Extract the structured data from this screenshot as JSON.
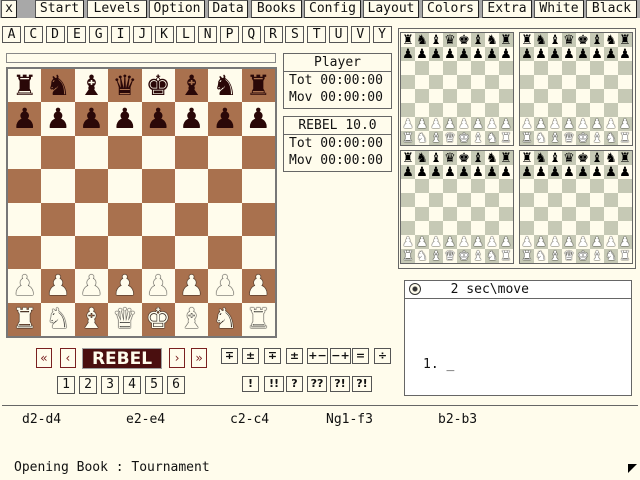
{
  "menu": {
    "close": "x",
    "items": [
      "Start",
      "Levels",
      "Option",
      "Data",
      "Books",
      "Config",
      "Layout",
      "Colors",
      "Extra",
      "White",
      "Black"
    ]
  },
  "letters": [
    "A",
    "C",
    "D",
    "E",
    "G",
    "I",
    "J",
    "K",
    "L",
    "N",
    "P",
    "Q",
    "R",
    "S",
    "T",
    "U",
    "V",
    "Y"
  ],
  "board": {
    "rows": [
      [
        "♜",
        "♞",
        "♝",
        "♛",
        "♚",
        "♝",
        "♞",
        "♜"
      ],
      [
        "♟",
        "♟",
        "♟",
        "♟",
        "♟",
        "♟",
        "♟",
        "♟"
      ],
      [
        "",
        "",
        "",
        "",
        "",
        "",
        "",
        ""
      ],
      [
        "",
        "",
        "",
        "",
        "",
        "",
        "",
        ""
      ],
      [
        "",
        "",
        "",
        "",
        "",
        "",
        "",
        ""
      ],
      [
        "",
        "",
        "",
        "",
        "",
        "",
        "",
        ""
      ],
      [
        "♟",
        "♟",
        "♟",
        "♟",
        "♟",
        "♟",
        "♟",
        "♟"
      ],
      [
        "♜",
        "♞",
        "♝",
        "♛",
        "♚",
        "♝",
        "♞",
        "♜"
      ]
    ],
    "colors": {
      "light": "#fffcec",
      "dark": "#a9714e"
    }
  },
  "clock_player": {
    "name": "Player",
    "tot": "Tot 00:00:00",
    "mov": "Mov 00:00:00"
  },
  "clock_engine": {
    "name": "REBEL 10.0",
    "tot": "Tot 00:00:00",
    "mov": "Mov 00:00:00"
  },
  "notation": {
    "level": "2 sec\\move",
    "move_line": "1.  _",
    "level_icon": "stopwatch-icon"
  },
  "nav": {
    "first": "«",
    "prev": "‹",
    "label": "REBEL",
    "next": "›",
    "last": "»",
    "numbers": [
      "1",
      "2",
      "3",
      "4",
      "5",
      "6"
    ]
  },
  "evals_row1": [
    "∓",
    "±",
    "∓",
    "±",
    "+−",
    "−+",
    "=",
    "÷"
  ],
  "evals_row2": [
    "!",
    "!!",
    "?",
    "??",
    "?!",
    "?!"
  ],
  "book_moves": [
    "d2-d4",
    "e2-e4",
    "c2-c4",
    "Ng1-f3",
    "b2-b3"
  ],
  "book_status": "Opening Book :  Tournament"
}
